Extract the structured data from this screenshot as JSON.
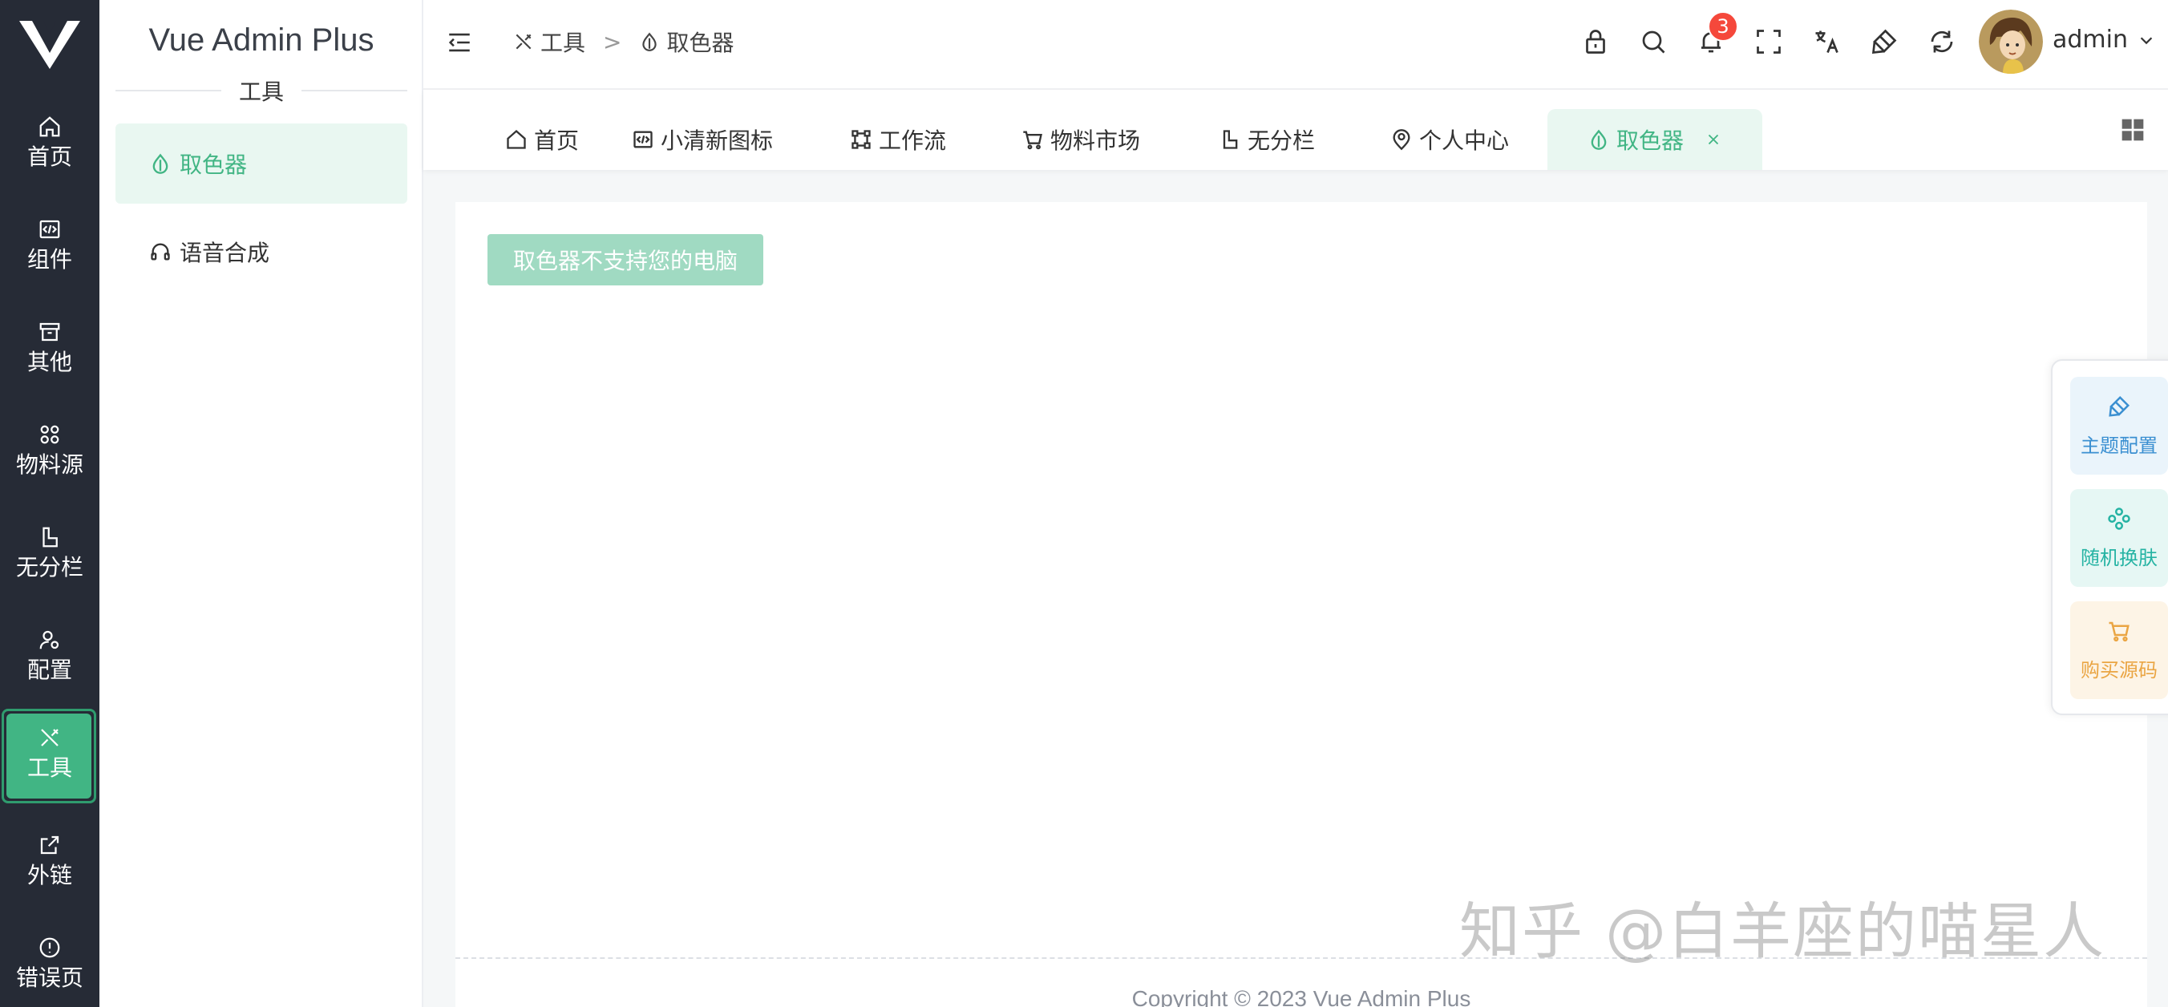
{
  "rail": {
    "items": [
      {
        "label": "首页",
        "icon": "home-icon"
      },
      {
        "label": "组件",
        "icon": "code-icon"
      },
      {
        "label": "其他",
        "icon": "archive-icon"
      },
      {
        "label": "物料源",
        "icon": "apps-icon"
      },
      {
        "label": "无分栏",
        "icon": "layout-icon"
      },
      {
        "label": "配置",
        "icon": "user-settings-icon"
      },
      {
        "label": "工具",
        "icon": "tools-icon"
      },
      {
        "label": "外链",
        "icon": "external-link-icon"
      },
      {
        "label": "错误页",
        "icon": "error-icon"
      }
    ],
    "active_index": 6
  },
  "subnav": {
    "brand": "Vue Admin Plus",
    "group": "工具",
    "items": [
      {
        "label": "取色器",
        "icon": "drop-icon"
      },
      {
        "label": "语音合成",
        "icon": "headset-icon"
      }
    ]
  },
  "header": {
    "breadcrumb": [
      {
        "label": "工具",
        "icon": "tools-icon"
      },
      {
        "label": "取色器",
        "icon": "drop-icon"
      }
    ],
    "breadcrumb_separator": ">",
    "notification_count": "3",
    "username": "admin"
  },
  "tabs": [
    {
      "label": "首页",
      "icon": "home-icon"
    },
    {
      "label": "小清新图标",
      "icon": "code-icon"
    },
    {
      "label": "工作流",
      "icon": "flow-icon"
    },
    {
      "label": "物料市场",
      "icon": "cart-icon"
    },
    {
      "label": "无分栏",
      "icon": "layout-icon"
    },
    {
      "label": "个人中心",
      "icon": "location-user-icon"
    },
    {
      "label": "取色器",
      "icon": "drop-icon",
      "active": true
    }
  ],
  "content": {
    "button_label": "取色器不支持您的电脑",
    "footer": "Copyright © 2023 Vue Admin Plus"
  },
  "float_panel": {
    "theme_label": "主题配置",
    "skin_label": "随机换肤",
    "buy_label": "购买源码"
  },
  "watermark": "知乎 @白羊座的喵星人",
  "colors": {
    "primary": "#41b584",
    "rail_bg": "#262b36",
    "badge": "#f5483b",
    "theme_blue": "#3a8fd1",
    "skin_teal": "#25b3a3",
    "buy_orange": "#eaa543"
  }
}
